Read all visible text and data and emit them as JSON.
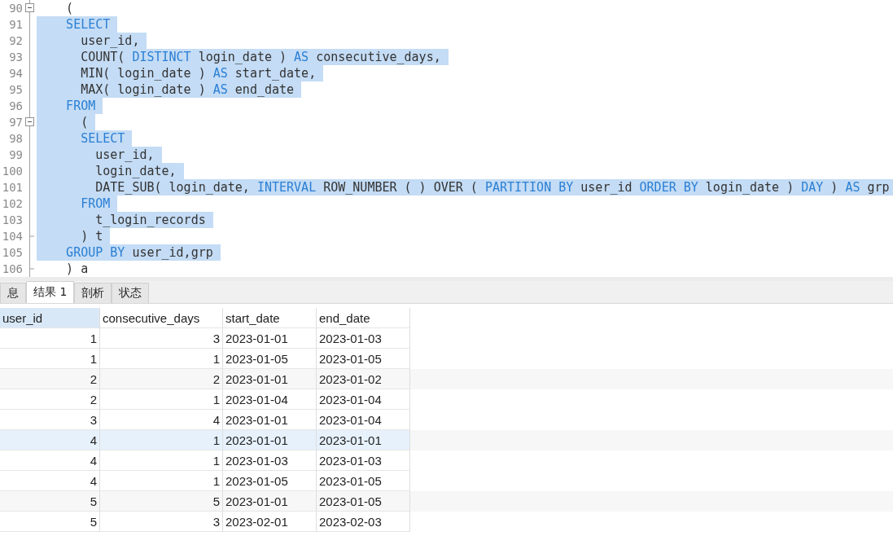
{
  "editor": {
    "lines": [
      {
        "number": "90",
        "expanded": true,
        "selected": false,
        "tokens": [
          {
            "text": "    (",
            "kind": "plain"
          }
        ]
      },
      {
        "number": "91",
        "selected": true,
        "tokens": [
          {
            "text": "    SELECT",
            "kind": "keyword"
          }
        ]
      },
      {
        "number": "92",
        "selected": true,
        "tokens": [
          {
            "text": "      user_id,",
            "kind": "plain"
          }
        ]
      },
      {
        "number": "93",
        "selected": true,
        "tokens": [
          {
            "text": "      COUNT( ",
            "kind": "plain"
          },
          {
            "text": "DISTINCT",
            "kind": "keyword"
          },
          {
            "text": " login_date ) ",
            "kind": "plain"
          },
          {
            "text": "AS",
            "kind": "keyword"
          },
          {
            "text": " consecutive_days,",
            "kind": "plain"
          }
        ]
      },
      {
        "number": "94",
        "selected": true,
        "tokens": [
          {
            "text": "      MIN( login_date ) ",
            "kind": "plain"
          },
          {
            "text": "AS",
            "kind": "keyword"
          },
          {
            "text": " start_date,",
            "kind": "plain"
          }
        ]
      },
      {
        "number": "95",
        "selected": true,
        "tokens": [
          {
            "text": "      MAX( login_date ) ",
            "kind": "plain"
          },
          {
            "text": "AS",
            "kind": "keyword"
          },
          {
            "text": " end_date",
            "kind": "plain"
          }
        ]
      },
      {
        "number": "96",
        "selected": true,
        "tokens": [
          {
            "text": "    FROM",
            "kind": "keyword"
          }
        ]
      },
      {
        "number": "97",
        "expanded": true,
        "selected": true,
        "tokens": [
          {
            "text": "      (",
            "kind": "plain"
          }
        ]
      },
      {
        "number": "98",
        "selected": true,
        "tokens": [
          {
            "text": "      SELECT",
            "kind": "keyword"
          }
        ]
      },
      {
        "number": "99",
        "selected": true,
        "tokens": [
          {
            "text": "        user_id,",
            "kind": "plain"
          }
        ]
      },
      {
        "number": "100",
        "selected": true,
        "tokens": [
          {
            "text": "        login_date,",
            "kind": "plain"
          }
        ]
      },
      {
        "number": "101",
        "selected": true,
        "tokens": [
          {
            "text": "        DATE_SUB( login_date, ",
            "kind": "plain"
          },
          {
            "text": "INTERVAL",
            "kind": "keyword"
          },
          {
            "text": " ROW_NUMBER ( ) OVER ( ",
            "kind": "plain"
          },
          {
            "text": "PARTITION BY",
            "kind": "keyword"
          },
          {
            "text": " user_id ",
            "kind": "plain"
          },
          {
            "text": "ORDER BY",
            "kind": "keyword"
          },
          {
            "text": " login_date ) ",
            "kind": "plain"
          },
          {
            "text": "DAY",
            "kind": "keyword"
          },
          {
            "text": " ) ",
            "kind": "plain"
          },
          {
            "text": "AS",
            "kind": "keyword"
          },
          {
            "text": " grp",
            "kind": "plain"
          }
        ]
      },
      {
        "number": "102",
        "selected": true,
        "tokens": [
          {
            "text": "      FROM",
            "kind": "keyword"
          }
        ]
      },
      {
        "number": "103",
        "selected": true,
        "tokens": [
          {
            "text": "        t_login_records",
            "kind": "plain"
          }
        ]
      },
      {
        "number": "104",
        "block_end": true,
        "selected": true,
        "tokens": [
          {
            "text": "      ) t",
            "kind": "plain"
          }
        ]
      },
      {
        "number": "105",
        "selected": true,
        "tokens": [
          {
            "text": "    GROUP BY",
            "kind": "keyword"
          },
          {
            "text": " user_id,grp",
            "kind": "plain"
          }
        ]
      },
      {
        "number": "106",
        "block_end": true,
        "selected": false,
        "tokens": [
          {
            "text": "    ) a",
            "kind": "plain"
          }
        ]
      }
    ]
  },
  "tabs": [
    {
      "label": "息",
      "selected": false
    },
    {
      "label": "结果 1",
      "selected": true
    },
    {
      "label": "剖析",
      "selected": false
    },
    {
      "label": "状态",
      "selected": false
    }
  ],
  "table": {
    "columns": [
      {
        "label": "user_id",
        "kind": "number",
        "selected": true
      },
      {
        "label": "consecutive_days",
        "kind": "number",
        "selected": false
      },
      {
        "label": "start_date",
        "kind": "text",
        "selected": false
      },
      {
        "label": "end_date",
        "kind": "text",
        "selected": false
      }
    ],
    "rows": [
      {
        "selected": false,
        "cells": [
          "1",
          "3",
          "2023-01-01",
          "2023-01-03"
        ]
      },
      {
        "selected": false,
        "cells": [
          "1",
          "1",
          "2023-01-05",
          "2023-01-05"
        ]
      },
      {
        "selected": false,
        "cells": [
          "2",
          "2",
          "2023-01-01",
          "2023-01-02"
        ]
      },
      {
        "selected": false,
        "cells": [
          "2",
          "1",
          "2023-01-04",
          "2023-01-04"
        ]
      },
      {
        "selected": false,
        "cells": [
          "3",
          "4",
          "2023-01-01",
          "2023-01-04"
        ]
      },
      {
        "selected": true,
        "cells": [
          "4",
          "1",
          "2023-01-01",
          "2023-01-01"
        ]
      },
      {
        "selected": false,
        "cells": [
          "4",
          "1",
          "2023-01-03",
          "2023-01-03"
        ]
      },
      {
        "selected": false,
        "cells": [
          "4",
          "1",
          "2023-01-05",
          "2023-01-05"
        ]
      },
      {
        "selected": false,
        "cells": [
          "5",
          "5",
          "2023-01-01",
          "2023-01-05"
        ]
      },
      {
        "selected": false,
        "cells": [
          "5",
          "3",
          "2023-02-01",
          "2023-02-03"
        ]
      }
    ]
  }
}
